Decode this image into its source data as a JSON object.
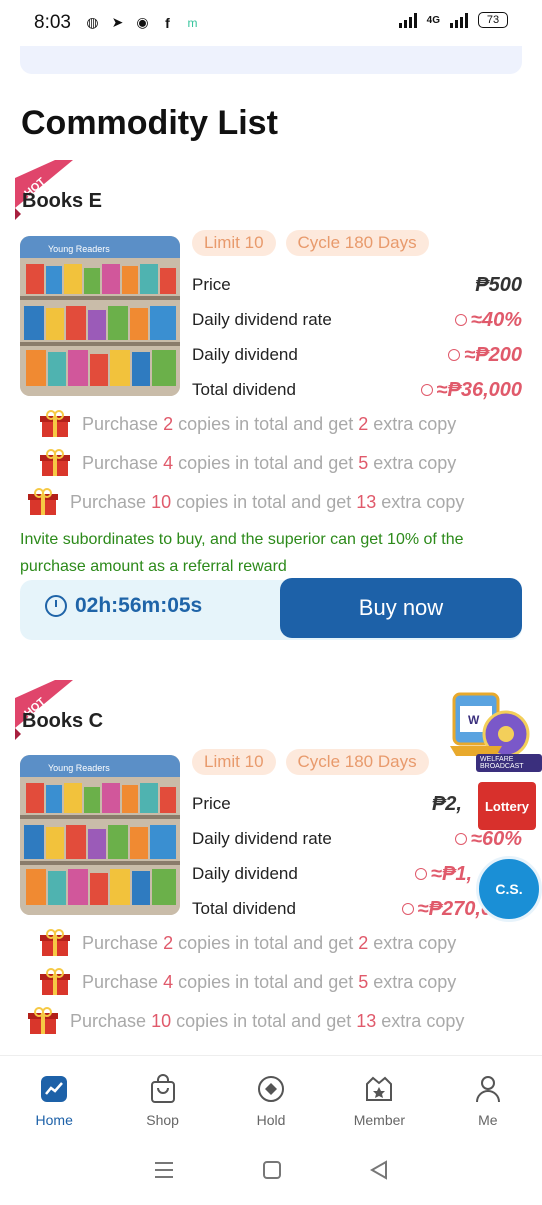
{
  "status_bar": {
    "time": "8:03",
    "network": "4G",
    "battery": "73",
    "icons": [
      "messenger-icon",
      "telegram-icon",
      "messenger-bolt-icon",
      "facebook-icon",
      "m-app-icon"
    ]
  },
  "section_title": "Commodity List",
  "products": [
    {
      "badge": "HOT",
      "name": "Books E",
      "image_caption": "Young Readers",
      "tags": [
        "Limit 10",
        "Cycle 180 Days"
      ],
      "rows": [
        {
          "label": "Price",
          "value": "₱500"
        },
        {
          "label": "Daily dividend rate",
          "value": "≈40%"
        },
        {
          "label": "Daily dividend",
          "value": "≈₱200"
        },
        {
          "label": "Total dividend",
          "value": "≈₱36,000"
        }
      ],
      "offers": [
        {
          "pre": "Purchase",
          "n1": "2",
          "mid": "copies in total and get",
          "n2": "2",
          "post": "extra copy"
        },
        {
          "pre": "Purchase",
          "n1": "4",
          "mid": "copies in total and get",
          "n2": "5",
          "post": "extra copy"
        },
        {
          "pre": "Purchase",
          "n1": "10",
          "mid": "copies in total and get",
          "n2": "13",
          "post": "extra copy"
        }
      ],
      "referral": "Invite subordinates to buy, and the superior can get 10% of the purchase amount as a referral reward",
      "timer": "02h:56m:05s",
      "buy_label": "Buy now"
    },
    {
      "badge": "HOT",
      "name": "Books C",
      "image_caption": "Young Readers",
      "tags": [
        "Limit 10",
        "Cycle 180 Days"
      ],
      "rows": [
        {
          "label": "Price",
          "value": "₱2,"
        },
        {
          "label": "Daily dividend rate",
          "value": "≈60%"
        },
        {
          "label": "Daily dividend",
          "value": "≈₱1,"
        },
        {
          "label": "Total dividend",
          "value": "≈₱270,0"
        }
      ],
      "offers": [
        {
          "pre": "Purchase",
          "n1": "2",
          "mid": "copies in total and get",
          "n2": "2",
          "post": "extra copy"
        },
        {
          "pre": "Purchase",
          "n1": "4",
          "mid": "copies in total and get",
          "n2": "5",
          "post": "extra copy"
        },
        {
          "pre": "Purchase",
          "n1": "10",
          "mid": "copies in total and get",
          "n2": "13",
          "post": "extra copy"
        }
      ]
    }
  ],
  "floating": {
    "welfare_label": "WELFARE BROADCAST",
    "lottery_label": "Lottery",
    "cs_label": "C.S."
  },
  "bottom_nav": [
    {
      "label": "Home",
      "icon": "home-chart-icon",
      "active": true
    },
    {
      "label": "Shop",
      "icon": "shop-bag-icon"
    },
    {
      "label": "Hold",
      "icon": "hold-icon"
    },
    {
      "label": "Member",
      "icon": "member-crown-icon"
    },
    {
      "label": "Me",
      "icon": "person-icon"
    }
  ],
  "colors": {
    "accent_blue": "#1d61a8",
    "dividend_red": "#e05a6b",
    "referral_green": "#2c8a1a",
    "tag_bg": "#fde9dc",
    "tag_text": "#e89a6c"
  }
}
